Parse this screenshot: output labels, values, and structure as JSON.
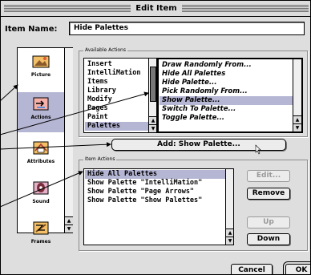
{
  "window": {
    "title": "Edit Item"
  },
  "item_name": {
    "label": "Item Name:",
    "value": "Hide Palettes"
  },
  "sidebar": {
    "items": [
      {
        "label": "Picture",
        "icon": "picture-icon",
        "selected": false
      },
      {
        "label": "Actions",
        "icon": "actions-icon",
        "selected": true
      },
      {
        "label": "Attributes",
        "icon": "attributes-icon",
        "selected": false
      },
      {
        "label": "Sound",
        "icon": "sound-icon",
        "selected": false
      },
      {
        "label": "Frames",
        "icon": "frames-icon",
        "selected": false
      }
    ]
  },
  "available_actions": {
    "group_label": "Available Actions",
    "categories": [
      "Insert",
      "IntelliMation",
      "Items",
      "Library",
      "Modify",
      "Pages",
      "Paint",
      "Palettes"
    ],
    "selected_category": "Palettes",
    "actions": [
      "Draw Randomly From...",
      "Hide All Palettes",
      "Hide Palette...",
      "Pick Randomly From...",
      "Show Palette...",
      "Switch To Palette...",
      "Toggle Palette..."
    ],
    "selected_action": "Show Palette..."
  },
  "add_button": {
    "label": "Add:  Show Palette..."
  },
  "item_actions": {
    "group_label": "Item Actions",
    "rows": [
      "Hide All Palettes",
      "Show Palette \"IntelliMation\"",
      "Show Palette \"Page Arrows\"",
      "Show Palette \"Show Palettes\""
    ],
    "selected_row": "Hide All Palettes"
  },
  "buttons": {
    "edit": "Edit...",
    "remove": "Remove",
    "up": "Up",
    "down": "Down",
    "cancel": "Cancel",
    "ok": "OK"
  }
}
